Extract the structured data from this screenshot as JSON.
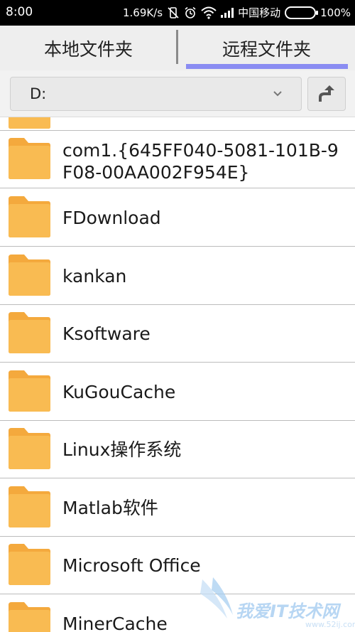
{
  "status_bar": {
    "time": "8:00",
    "speed": "1.69K/s",
    "carrier": "中国移动",
    "battery": "100%"
  },
  "tabs": [
    {
      "label": "本地文件夹",
      "active": false
    },
    {
      "label": "远程文件夹",
      "active": true
    }
  ],
  "toolbar": {
    "path": "D:"
  },
  "folders": [
    {
      "name": "com1.{645FF040-5081-101B-9F08-00AA002F954E}"
    },
    {
      "name": "FDownload"
    },
    {
      "name": "kankan"
    },
    {
      "name": "Ksoftware"
    },
    {
      "name": "KuGouCache"
    },
    {
      "name": "Linux操作系统"
    },
    {
      "name": "Matlab软件"
    },
    {
      "name": "Microsoft Office"
    },
    {
      "name": "MinerCache"
    }
  ],
  "watermark": {
    "text": "我爱IT技术网",
    "sub": "www.52ij.com"
  },
  "colors": {
    "folder": "#f7b64b",
    "tab_indicator": "#8a8cf2",
    "battery": "#3cc43c"
  }
}
